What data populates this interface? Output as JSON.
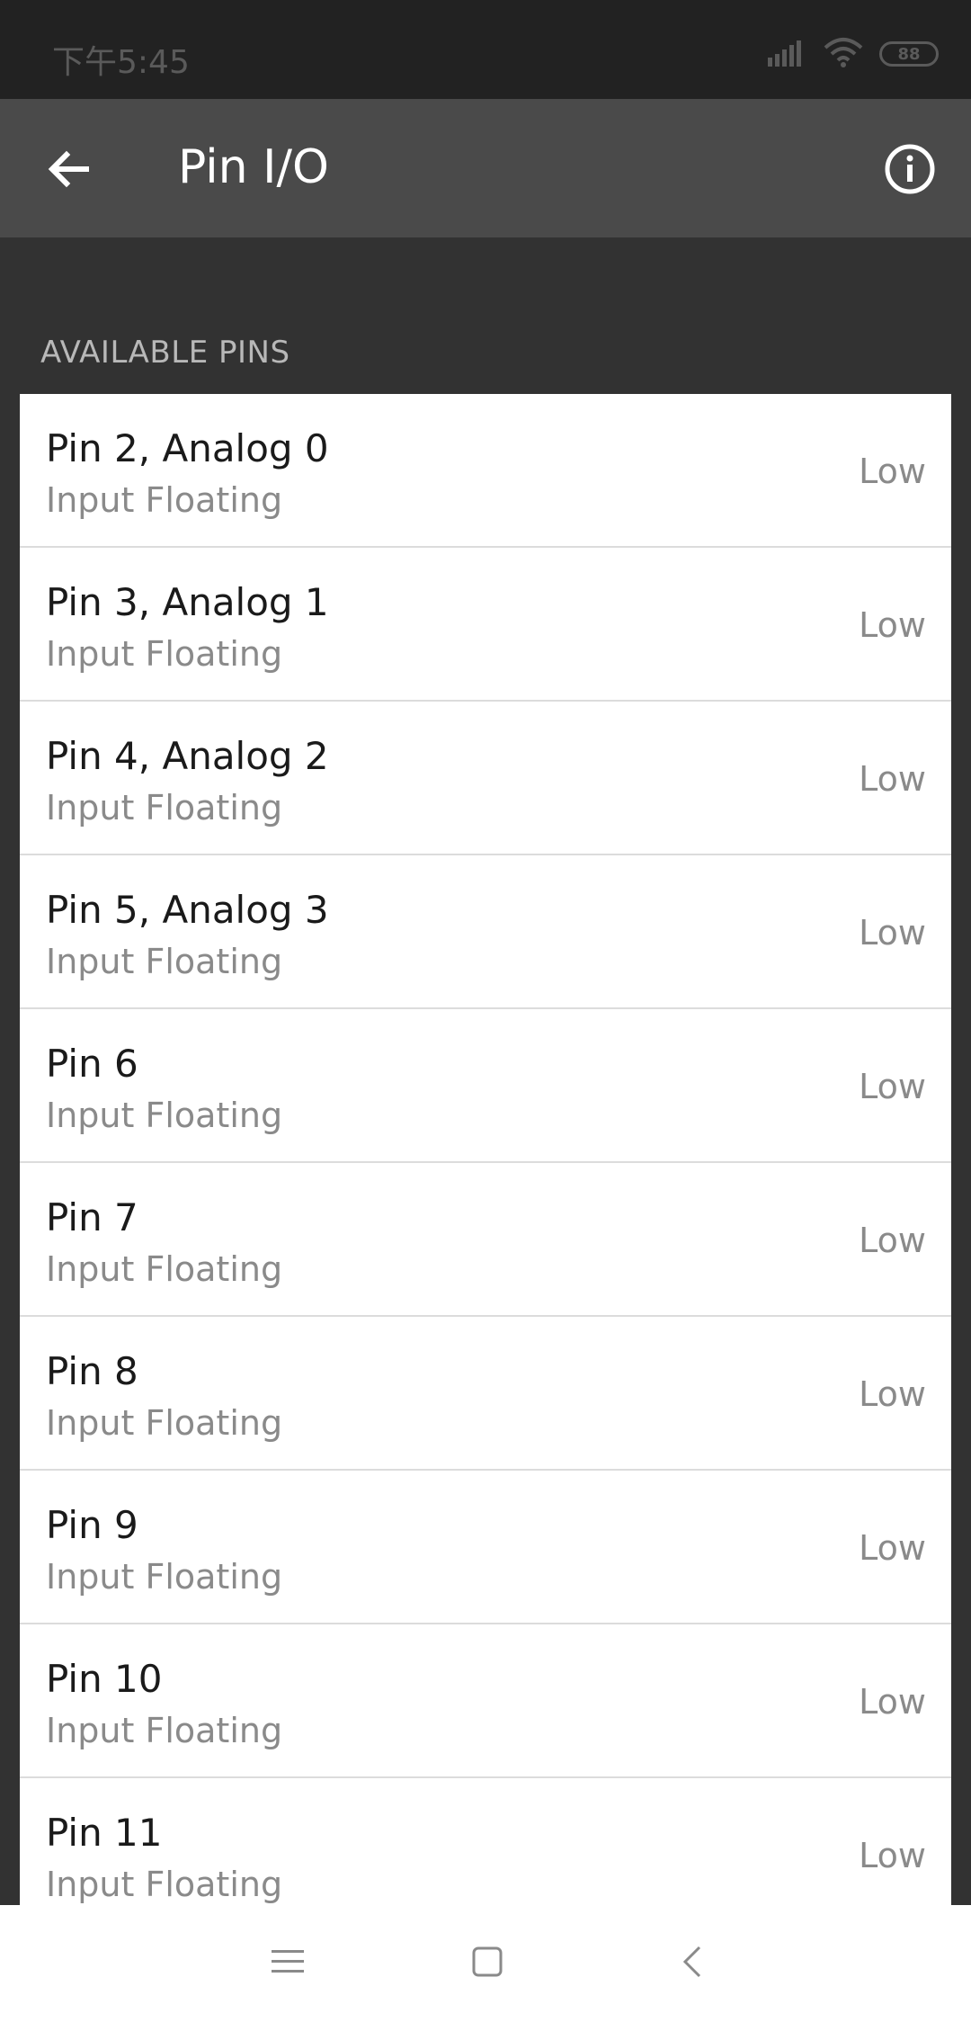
{
  "status_bar": {
    "time": "下午5:45",
    "battery": "88",
    "icons": [
      "signal-icon",
      "wifi-icon",
      "battery-icon"
    ]
  },
  "app_bar": {
    "title": "Pin I/O",
    "back_icon": "arrow-back-icon",
    "info_icon": "info-icon"
  },
  "section": {
    "title": "AVAILABLE PINS"
  },
  "pins": [
    {
      "name": "Pin 2, Analog 0",
      "mode": "Input Floating",
      "state": "Low"
    },
    {
      "name": "Pin 3, Analog 1",
      "mode": "Input Floating",
      "state": "Low"
    },
    {
      "name": "Pin 4, Analog 2",
      "mode": "Input Floating",
      "state": "Low"
    },
    {
      "name": "Pin 5, Analog 3",
      "mode": "Input Floating",
      "state": "Low"
    },
    {
      "name": "Pin 6",
      "mode": "Input Floating",
      "state": "Low"
    },
    {
      "name": "Pin 7",
      "mode": "Input Floating",
      "state": "Low"
    },
    {
      "name": "Pin 8",
      "mode": "Input Floating",
      "state": "Low"
    },
    {
      "name": "Pin 9",
      "mode": "Input Floating",
      "state": "Low"
    },
    {
      "name": "Pin 10",
      "mode": "Input Floating",
      "state": "Low"
    },
    {
      "name": "Pin 11",
      "mode": "Input Floating",
      "state": "Low"
    }
  ],
  "nav_bar": {
    "icons": [
      "menu-icon",
      "home-icon",
      "back-icon"
    ]
  },
  "colors": {
    "status_bar": "#222222",
    "app_bar": "#4a4a4a",
    "background": "#323232",
    "list_bg": "#ffffff"
  }
}
